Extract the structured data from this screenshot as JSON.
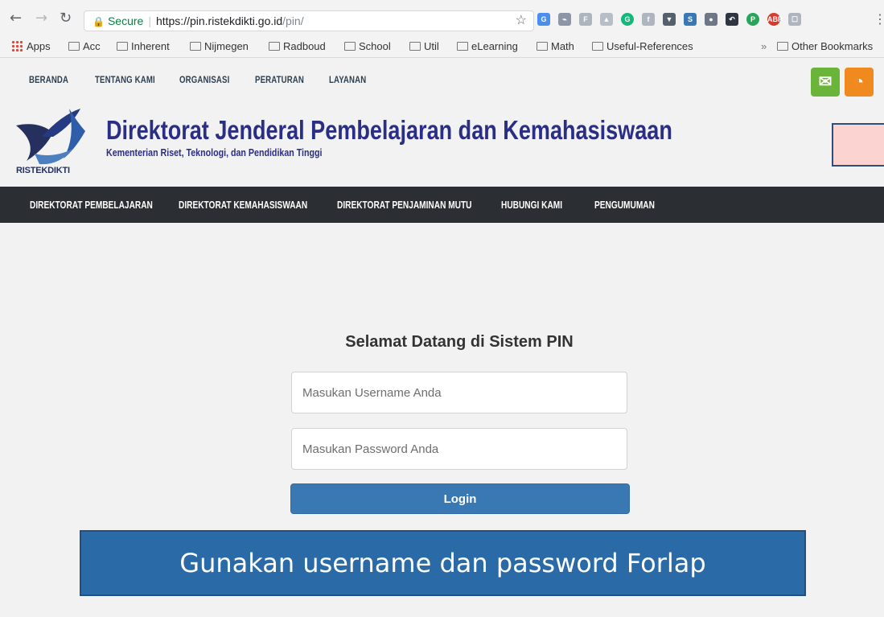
{
  "browser": {
    "security_label": "Secure",
    "url_main": "https://pin.ristekdikti.go.id",
    "url_path": "/pin/",
    "bookmarks": [
      "Apps",
      "Acc",
      "Inherent",
      "Nijmegen",
      "Radboud",
      "School",
      "Util",
      "eLearning",
      "Math",
      "Useful-References"
    ],
    "bookmark_overflow": "»",
    "other_bookmarks": "Other Bookmarks"
  },
  "site": {
    "top_links": [
      "BERANDA",
      "TENTANG KAMI",
      "ORGANISASI",
      "PERATURAN",
      "LAYANAN"
    ],
    "logo_text": "RISTEKDIKTI",
    "title": "Direktorat Jenderal Pembelajaran dan Kemahasiswaan",
    "subtitle": "Kementerian Riset, Teknologi, dan Pendidikan Tinggi",
    "main_nav": [
      "DIREKTORAT PEMBELAJARAN",
      "DIREKTORAT KEMAHASISWAAN",
      "DIREKTORAT PENJAMINAN MUTU",
      "HUBUNGI KAMI",
      "PENGUMUMAN"
    ]
  },
  "login": {
    "welcome": "Selamat Datang di Sistem PIN",
    "username_placeholder": "Masukan Username Anda",
    "password_placeholder": "Masukan Password Anda",
    "button": "Login"
  },
  "callout": {
    "text": "Gunakan username dan password Forlap"
  },
  "colors": {
    "callout_bg": "#2a6aa7",
    "login_button": "#3a78b4",
    "title_color": "#2b2e85",
    "dark_nav": "#2b2f33"
  }
}
